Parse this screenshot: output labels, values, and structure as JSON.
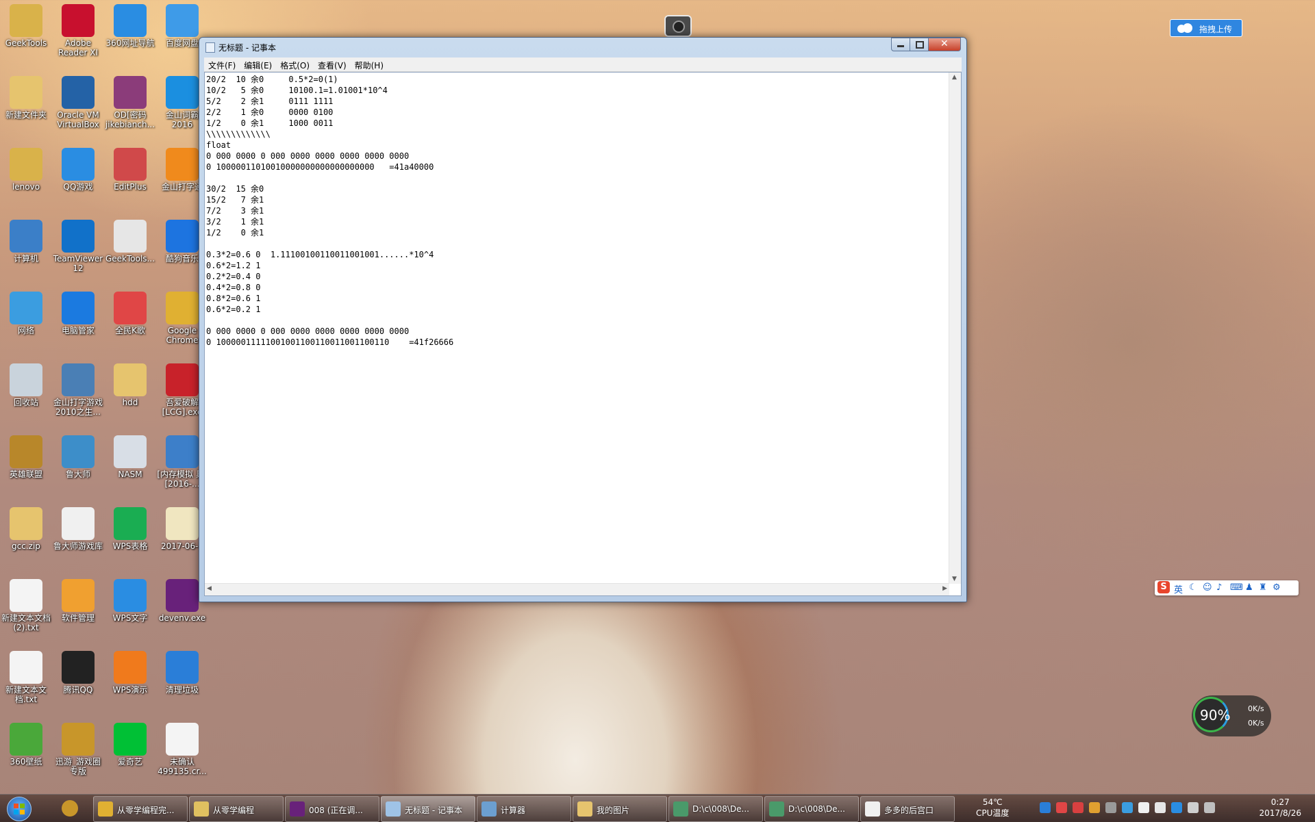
{
  "desktop_icons": [
    {
      "label": "GeekTools",
      "color": "#d9b24a"
    },
    {
      "label": "Adobe Reader XI",
      "color": "#c8102e"
    },
    {
      "label": "360网址导航",
      "color": "#2a8de2"
    },
    {
      "label": "百度网盘",
      "color": "#3e9be8"
    },
    {
      "label": "新建文件夹",
      "color": "#e6c46e"
    },
    {
      "label": "Oracle VM VirtualBox",
      "color": "#2462a6"
    },
    {
      "label": "OD[密码 jikebianch...",
      "color": "#8b3c7a"
    },
    {
      "label": "金山词霸 2016",
      "color": "#1b8fe0"
    },
    {
      "label": "lenovo",
      "color": "#d9b24a"
    },
    {
      "label": "QQ游戏",
      "color": "#2a8de2"
    },
    {
      "label": "EditPlus",
      "color": "#d0494a"
    },
    {
      "label": "金山打字通",
      "color": "#f08a1c"
    },
    {
      "label": "计算机",
      "color": "#3b7fc8"
    },
    {
      "label": "TeamViewer 12",
      "color": "#1171c9"
    },
    {
      "label": "GeekTools...",
      "color": "#e6e6e6"
    },
    {
      "label": "酷狗音乐",
      "color": "#1d74e0"
    },
    {
      "label": "网络",
      "color": "#3b9de0"
    },
    {
      "label": "电脑管家",
      "color": "#1b7ae0"
    },
    {
      "label": "全民K歌",
      "color": "#e04646"
    },
    {
      "label": "Google Chrome",
      "color": "#e0b032"
    },
    {
      "label": "回收站",
      "color": "#c9d3dc"
    },
    {
      "label": "金山打字游戏 2010之生...",
      "color": "#4a7fb5"
    },
    {
      "label": "hdd",
      "color": "#e6c46e"
    },
    {
      "label": "吾爱破解 [LCG].exe",
      "color": "#c8222a"
    },
    {
      "label": "英雄联盟",
      "color": "#b8872a"
    },
    {
      "label": "鲁大师",
      "color": "#3d8ec9"
    },
    {
      "label": "NASM",
      "color": "#d8dee6"
    },
    {
      "label": "[内存模拟 具][2016-...",
      "color": "#3d7fc9"
    },
    {
      "label": "gcc.zip",
      "color": "#e6c46e"
    },
    {
      "label": "鲁大师游戏库",
      "color": "#f0f0f0"
    },
    {
      "label": "WPS表格",
      "color": "#1aad52"
    },
    {
      "label": "2017-06-1",
      "color": "#f0e6c0"
    },
    {
      "label": "新建文本文档 (2).txt",
      "color": "#f4f4f4"
    },
    {
      "label": "软件管理",
      "color": "#f0a030"
    },
    {
      "label": "WPS文字",
      "color": "#2a8de2"
    },
    {
      "label": "devenv.exe",
      "color": "#68217a"
    },
    {
      "label": "新建文本文 档.txt",
      "color": "#f4f4f4"
    },
    {
      "label": "腾讯QQ",
      "color": "#222222"
    },
    {
      "label": "WPS演示",
      "color": "#f07a1c"
    },
    {
      "label": "清理垃圾",
      "color": "#2a7ed8"
    },
    {
      "label": "360壁纸",
      "color": "#4aa83a"
    },
    {
      "label": "迅游_游戏圈 专版",
      "color": "#c8962a"
    },
    {
      "label": "爱奇艺",
      "color": "#00c035"
    },
    {
      "label": "未确认 499135.cr...",
      "color": "#f4f4f4"
    }
  ],
  "notepad": {
    "title": "无标题 - 记事本",
    "menu": [
      "文件(F)",
      "编辑(E)",
      "格式(O)",
      "查看(V)",
      "帮助(H)"
    ],
    "text": "20/2  10 余0     0.5*2=0(1)\n10/2   5 余0     10100.1=1.01001*10^4\n5/2    2 余1     0111 1111\n2/2    1 余0     0000 0100\n1/2    0 余1     1000 0011\n\\\\\\\\\\\\\\\\\\\\\\\\\\\nfloat\n0 000 0000 0 000 0000 0000 0000 0000 0000\n0 10000011010010000000000000000000   =41a40000\n\n30/2  15 余0\n15/2   7 余1\n7/2    3 余1\n3/2    1 余1\n1/2    0 余1\n\n0.3*2=0.6 0  1.11100100110011001001......*10^4\n0.6*2=1.2 1\n0.2*2=0.4 0\n0.4*2=0.8 0\n0.8*2=0.6 1\n0.6*2=0.2 1\n\n0 000 0000 0 000 0000 0000 0000 0000 0000\n0 10000011111001001100110011001100110    =41f26666\n\n"
  },
  "upload_label": "拖拽上传",
  "ime_items": [
    "英"
  ],
  "net_meter": {
    "percent": "90%",
    "up": "0K/s",
    "down": "0K/s"
  },
  "taskbar": {
    "buttons": [
      {
        "label": "从零学编程完...",
        "color": "#e0b032"
      },
      {
        "label": "从零学编程",
        "color": "#e0c060"
      },
      {
        "label": "008 (正在调...",
        "color": "#68217a"
      },
      {
        "label": "无标题 - 记事本",
        "color": "#9fc3e6"
      },
      {
        "label": "计算器",
        "color": "#6c9fd0"
      },
      {
        "label": "我的图片",
        "color": "#e6c46e"
      },
      {
        "label": "D:\\c\\008\\De...",
        "color": "#4a9a6a"
      },
      {
        "label": "D:\\c\\008\\De...",
        "color": "#4a9a6a"
      },
      {
        "label": "多多的后宫口",
        "color": "#f0f0f0"
      }
    ],
    "temperature": "54℃",
    "temp_label": "CPU温度",
    "time": "0:27",
    "date": "2017/8/26"
  }
}
